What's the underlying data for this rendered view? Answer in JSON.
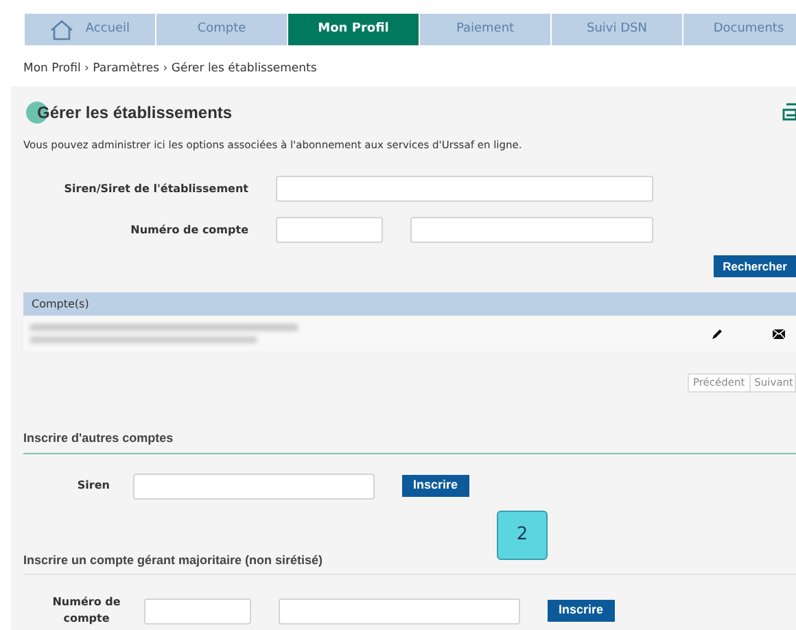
{
  "tabs": [
    {
      "label": "Accueil",
      "kind": "home",
      "selected": false
    },
    {
      "label": "Compte",
      "selected": false
    },
    {
      "label": "Mon Profil",
      "selected": true
    },
    {
      "label": "Paiement",
      "selected": false
    },
    {
      "label": "Suivi DSN",
      "selected": false
    },
    {
      "label": "Documents",
      "selected": false
    }
  ],
  "breadcrumb": "Mon Profil › Paramètres › Gérer les établissements",
  "panel": {
    "title": "Gérer les établissements",
    "description": "Vous pouvez administrer ici les options associées à l'abonnement aux services d'Urssaf en ligne.",
    "search_form": {
      "siret_label": "Siren/Siret de l'établissement",
      "account_label": "Numéro de compte",
      "button": "Rechercher"
    },
    "accounts_table": {
      "header": "Compte(s)",
      "rows": [
        {
          "kind": "redacted"
        }
      ]
    },
    "pagination": {
      "previous": "Précédent",
      "next": "Suivant"
    },
    "register_others": {
      "title": "Inscrire d'autres comptes",
      "siren_label": "Siren",
      "button": "Inscrire"
    },
    "badge": "2",
    "register_manager": {
      "title": "Inscrire un compte gérant majoritaire (non sirétisé)",
      "account_label": "Numéro de compte",
      "button": "Inscrire"
    }
  }
}
